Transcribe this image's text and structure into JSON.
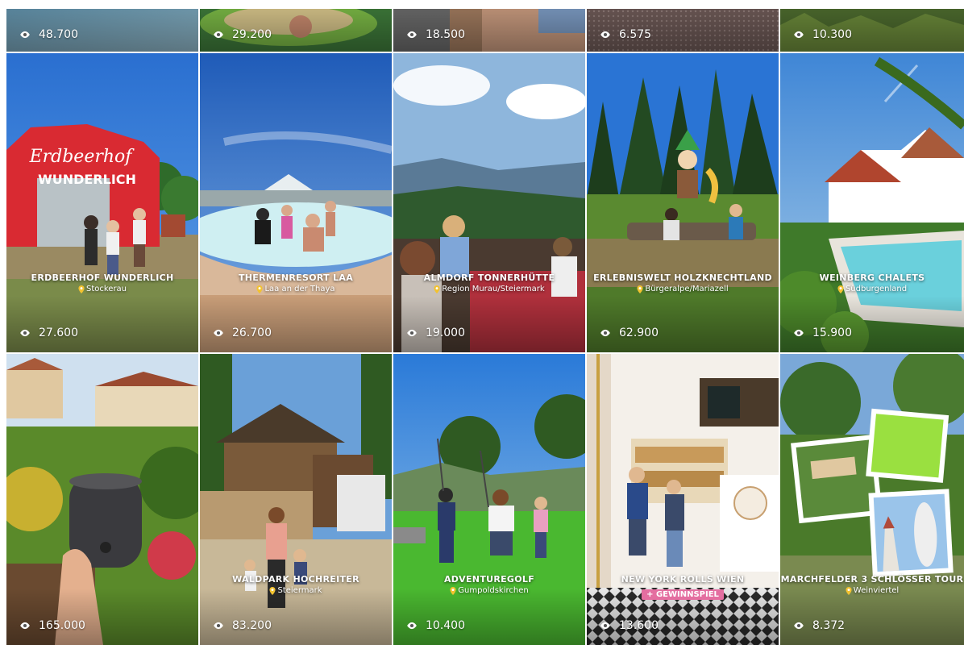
{
  "top_row": [
    {
      "views": "48.700"
    },
    {
      "views": "29.200"
    },
    {
      "views": "18.500"
    },
    {
      "views": "6.575"
    },
    {
      "views": "10.300"
    }
  ],
  "row2": [
    {
      "title": "Erdbeerhof Wunderlich",
      "location": "Stockerau",
      "views": "27.600"
    },
    {
      "title": "Thermenresort Laa",
      "location": "Laa an der Thaya",
      "views": "26.700"
    },
    {
      "title": "Almdorf Tonnerhütte",
      "location": "Region Murau/Steiermark",
      "views": "19.000"
    },
    {
      "title": "Erlebniswelt Holzknechtland",
      "location": "Bürgeralpe/Mariazell",
      "views": "62.900"
    },
    {
      "title": "Weinberg Chalets",
      "location": "Südburgenland",
      "views": "15.900"
    }
  ],
  "row3": [
    {
      "views": "165.000"
    },
    {
      "title": "Waldpark Hochreiter",
      "location": "Steiermark",
      "views": "83.200"
    },
    {
      "title": "Adventuregolf",
      "location": "Gumpoldskirchen",
      "views": "10.400"
    },
    {
      "title": "New York Rolls Wien",
      "badge": "+ GEWINNSPIEL",
      "views": "13.600"
    },
    {
      "title": "Marchfelder 3 Schlösser Tour",
      "location": "Weinviertel",
      "views": "8.372"
    }
  ],
  "badge_color": "#e46ea0",
  "icons": {
    "views": "eye-icon",
    "location": "location-pin-icon"
  }
}
